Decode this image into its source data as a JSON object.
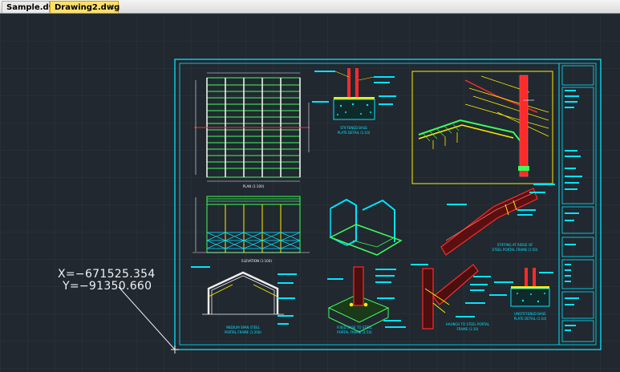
{
  "tabs": [
    {
      "label": "Sample.dwg",
      "active": false
    },
    {
      "label": "Drawing2.dwg",
      "active": true
    }
  ],
  "close_glyph": "✕",
  "cursor": {
    "x_label": "X=−671525.354",
    "y_label": "Y=−91350.660"
  },
  "drawing": {
    "labels": {
      "plan": "PLAN (1:100)",
      "elevation": "ELEVATION (1:100)",
      "base_title": "STIFFENED BASE",
      "base_sub": "PLATE DETAIL (1:10)",
      "ridge_title": "STIFFING AT RIDGE OF",
      "ridge_sub": "STEEL PORTAL FRAME (1:50)",
      "span_title": "MEDIUM SPAN STEEL",
      "span_sub": "PORTAL FRAME (1:200)",
      "fixed_title": "FIXED BASE TO STEEL",
      "fixed_sub": "PORTAL FRAME (1:50)",
      "haunch_title": "HAUNCH TO STEEL PORTAL",
      "haunch_sub": "FRAME (1:10)",
      "unstiff_title": "UNSTIFFENED BASE",
      "unstiff_sub": "PLATE DETAIL (1:10)"
    }
  },
  "colors": {
    "background": "#212830",
    "cyan": "#00e5ff",
    "green": "#3cff5a",
    "yellow": "#ffee00",
    "red": "#ff2a2a",
    "white": "#f0f0f0",
    "grid": "#2b333c"
  }
}
